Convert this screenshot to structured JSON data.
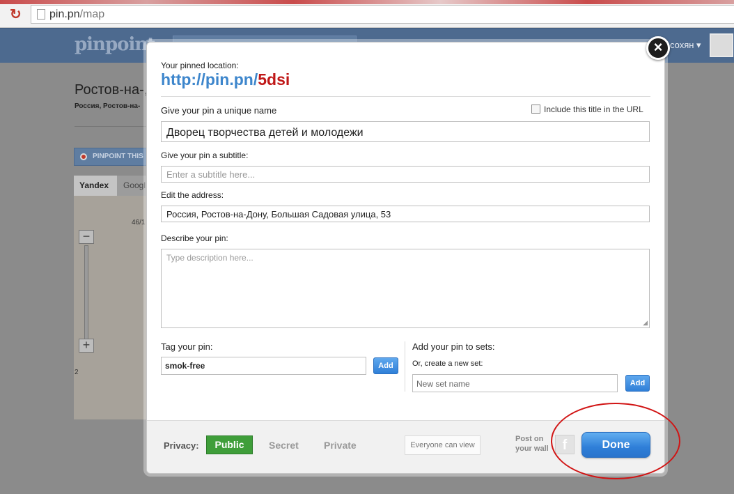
{
  "browser": {
    "url_host": "pin.pn",
    "url_path": "/map"
  },
  "site": {
    "logo": "pinpoint",
    "user_name": "сохян ▾"
  },
  "background": {
    "title": "Ростов-на-,",
    "subtitle": "Россия, Ростов-на-",
    "pinpoint_button": "PINPOINT THIS",
    "map_tabs": [
      "Yandex",
      "Googl"
    ],
    "map_labels": [
      "46/1",
      "2"
    ],
    "zoom_in": "+",
    "zoom_out": "−"
  },
  "modal": {
    "pinned_location_label": "Your pinned location:",
    "pin_url_prefix": "http://pin.pn/",
    "pin_url_code": "5dsi",
    "name_label": "Give your pin a unique name",
    "include_title_label": "Include this title in the URL",
    "name_value": "Дворец творчества детей и молодежи",
    "subtitle_label": "Give your pin a subtitle:",
    "subtitle_placeholder": "Enter  a subtitle here...",
    "address_label": "Edit the address:",
    "address_value": "Россия, Ростов-на-Дону, Большая Садовая улица, 53",
    "describe_label": "Describe your pin:",
    "describe_placeholder": "Type description here...",
    "tag_label": "Tag your pin:",
    "tag_value": "smok-free",
    "tag_add": "Add",
    "sets_label": "Add your pin to sets:",
    "new_set_label": "Or, create a new set:",
    "new_set_placeholder": "New set name",
    "set_add": "Add",
    "close": "×"
  },
  "footer": {
    "privacy_label": "Privacy:",
    "privacy_options": [
      "Public",
      "Secret",
      "Private"
    ],
    "privacy_selected": "Public",
    "visibility_note": "Everyone can view",
    "post_on_line1": "Post on",
    "post_on_line2": "your wall",
    "facebook_icon": "f",
    "done": "Done"
  },
  "colors": {
    "accent_blue": "#3d86cc",
    "pin_code_red": "#c01818",
    "public_green": "#3f9e3a",
    "highlight_ellipse": "#d11414"
  }
}
